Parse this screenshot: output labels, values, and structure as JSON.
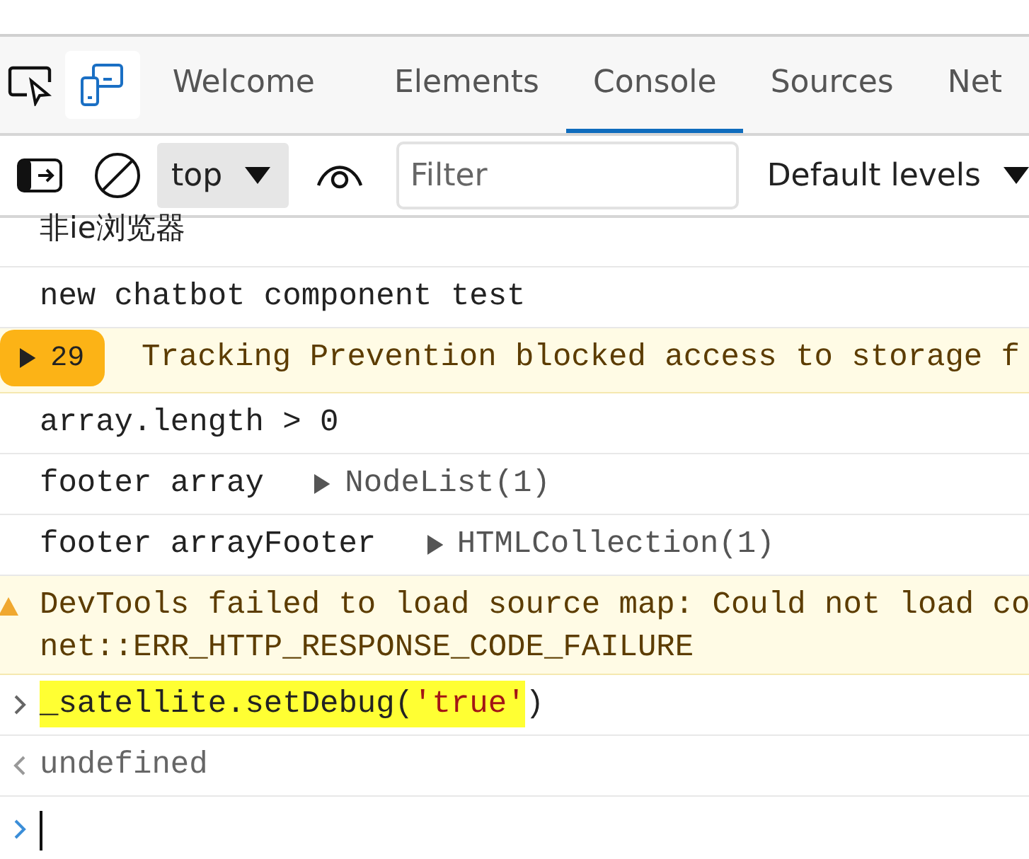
{
  "tabs": [
    {
      "label": "Welcome",
      "selected": false
    },
    {
      "label": "Elements",
      "selected": false
    },
    {
      "label": "Console",
      "selected": true
    },
    {
      "label": "Sources",
      "selected": false
    },
    {
      "label": "Net",
      "selected": false
    }
  ],
  "toolbar": {
    "context": "top",
    "filter": {
      "placeholder": "Filter"
    },
    "levels": "Default levels"
  },
  "messages": [
    {
      "kind": "log",
      "text": "非ie浏览器"
    },
    {
      "kind": "log",
      "text": "new chatbot component test"
    },
    {
      "kind": "warning-group",
      "count": "29",
      "text": "Tracking Prevention blocked access to storage f"
    },
    {
      "kind": "log",
      "text": "array.length > 0"
    },
    {
      "kind": "object",
      "text": "footer array",
      "object": "NodeList(1)"
    },
    {
      "kind": "object",
      "text": "footer arrayFooter",
      "object": "HTMLCollection(1)"
    },
    {
      "kind": "warning",
      "lines": [
        "DevTools failed to load source map: Could not load co",
        "net::ERR_HTTP_RESPONSE_CODE_FAILURE"
      ]
    },
    {
      "kind": "input",
      "code": "_satellite.setDebug(",
      "string": "'true'",
      "code_end": ")",
      "highlighted": true
    },
    {
      "kind": "output",
      "text": "undefined"
    },
    {
      "kind": "prompt"
    }
  ]
}
